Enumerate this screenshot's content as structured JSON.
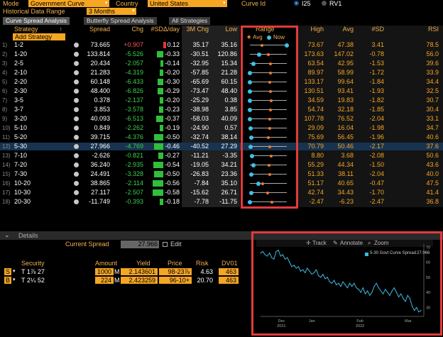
{
  "top": {
    "mode_label": "Mode",
    "mode_value": "Government Curve",
    "country_label": "Country",
    "country_value": "United States",
    "curve_id_label": "Curve Id",
    "radio1": "I25",
    "radio2": "RV1",
    "hist_label": "Historical Data Range",
    "hist_value": "3 Months"
  },
  "tabs": [
    "Curve Spread Analysis",
    "Butterfly Spread Analysis",
    "All Strategies"
  ],
  "columns": {
    "strategy": "Strategy",
    "spread": "Spread",
    "chg": "Chg",
    "sd_day": "#SDΔ/day",
    "chg3m": "3M Chg",
    "low": "Low",
    "range": "Range",
    "high": "High",
    "avg": "Avg",
    "sd": "#SD",
    "rsi": "RSI"
  },
  "legend": {
    "avg": "Avg",
    "now": "Now"
  },
  "add_strategy": "Add Strategy",
  "rows": [
    {
      "n": "1)",
      "name": "1-2",
      "spread": "73.665",
      "chg": "+0.907",
      "sd_day": "0.12",
      "chg3m": "35.17",
      "low": "35.16",
      "high": "73.67",
      "avg": "47.38",
      "sd": "3.41",
      "rsi": "78.5",
      "pos_now": 1.0,
      "pos_avg": 0.32,
      "bar": 0.2
    },
    {
      "n": "2)",
      "name": "1-20",
      "spread": "133.814",
      "chg": "-5.526",
      "sd_day": "-0.33",
      "chg3m": "-30.51",
      "low": "120.86",
      "high": "173.63",
      "avg": "147.02",
      "sd": "-0.78",
      "rsi": "56.0",
      "pos_now": 0.25,
      "pos_avg": 0.5,
      "bar": -0.5
    },
    {
      "n": "3)",
      "name": "2-5",
      "spread": "20.434",
      "chg": "-2.057",
      "sd_day": "-0.14",
      "chg3m": "-32.95",
      "low": "15.34",
      "high": "63.54",
      "avg": "42.95",
      "sd": "-1.53",
      "rsi": "39.6",
      "pos_now": 0.1,
      "pos_avg": 0.55,
      "bar": -0.2
    },
    {
      "n": "4)",
      "name": "2-10",
      "spread": "21.283",
      "chg": "-4.319",
      "sd_day": "-0.20",
      "chg3m": "-57.85",
      "low": "21.28",
      "high": "89.97",
      "avg": "58.99",
      "sd": "-1.72",
      "rsi": "33.9",
      "pos_now": 0.0,
      "pos_avg": 0.55,
      "bar": -0.3
    },
    {
      "n": "5)",
      "name": "2-20",
      "spread": "60.148",
      "chg": "-6.433",
      "sd_day": "-0.30",
      "chg3m": "-65.69",
      "low": "60.15",
      "high": "133.17",
      "avg": "99.64",
      "sd": "-1.84",
      "rsi": "34.4",
      "pos_now": 0.0,
      "pos_avg": 0.54,
      "bar": -0.45
    },
    {
      "n": "6)",
      "name": "2-30",
      "spread": "48.400",
      "chg": "-6.826",
      "sd_day": "-0.29",
      "chg3m": "-73.47",
      "low": "48.40",
      "high": "130.51",
      "avg": "93.41",
      "sd": "-1.93",
      "rsi": "32.5",
      "pos_now": 0.0,
      "pos_avg": 0.55,
      "bar": -0.43
    },
    {
      "n": "7)",
      "name": "3-5",
      "spread": "0.378",
      "chg": "-2.137",
      "sd_day": "-0.20",
      "chg3m": "-25.29",
      "low": "0.38",
      "high": "34.59",
      "avg": "19.83",
      "sd": "-1.82",
      "rsi": "30.7",
      "pos_now": 0.0,
      "pos_avg": 0.57,
      "bar": -0.3
    },
    {
      "n": "8)",
      "name": "3-7",
      "spread": "3.853",
      "chg": "-3.578",
      "sd_day": "-0.23",
      "chg3m": "-38.98",
      "low": "3.85",
      "high": "54.74",
      "avg": "32.18",
      "sd": "-1.85",
      "rsi": "30.4",
      "pos_now": 0.0,
      "pos_avg": 0.56,
      "bar": -0.35
    },
    {
      "n": "9)",
      "name": "3-20",
      "spread": "40.093",
      "chg": "-6.513",
      "sd_day": "-0.37",
      "chg3m": "-58.03",
      "low": "40.09",
      "high": "107.78",
      "avg": "76.52",
      "sd": "-2.04",
      "rsi": "33.1",
      "pos_now": 0.0,
      "pos_avg": 0.54,
      "bar": -0.55
    },
    {
      "n": "10)",
      "name": "5-10",
      "spread": "0.849",
      "chg": "-2.262",
      "sd_day": "-0.19",
      "chg3m": "-24.90",
      "low": "0.57",
      "high": "29.09",
      "avg": "16.04",
      "sd": "-1.98",
      "rsi": "34.7",
      "pos_now": 0.01,
      "pos_avg": 0.54,
      "bar": -0.28
    },
    {
      "n": "11)",
      "name": "5-20",
      "spread": "39.715",
      "chg": "-4.376",
      "sd_day": "-0.50",
      "chg3m": "-32.74",
      "low": "38.14",
      "high": "75.69",
      "avg": "56.45",
      "sd": "-1.96",
      "rsi": "40.6",
      "pos_now": 0.04,
      "pos_avg": 0.5,
      "bar": -0.75
    },
    {
      "n": "12)",
      "name": "5-30",
      "spread": "27.966",
      "chg": "-4.769",
      "sd_day": "-0.46",
      "chg3m": "-40.52",
      "low": "27.29",
      "high": "70.79",
      "avg": "50.46",
      "sd": "-2.17",
      "rsi": "37.6",
      "pos_now": 0.02,
      "pos_avg": 0.53,
      "bar": -0.7,
      "sel": true
    },
    {
      "n": "13)",
      "name": "7-10",
      "spread": "-2.626",
      "chg": "-0.821",
      "sd_day": "-0.27",
      "chg3m": "-11.21",
      "low": "-3.35",
      "high": "8.80",
      "avg": "3.68",
      "sd": "-2.08",
      "rsi": "50.6",
      "pos_now": 0.06,
      "pos_avg": 0.58,
      "bar": -0.4
    },
    {
      "n": "14)",
      "name": "7-20",
      "spread": "36.240",
      "chg": "-2.935",
      "sd_day": "-0.54",
      "chg3m": "-19.05",
      "low": "34.21",
      "high": "55.29",
      "avg": "44.34",
      "sd": "-1.50",
      "rsi": "43.6",
      "pos_now": 0.1,
      "pos_avg": 0.52,
      "bar": -0.8
    },
    {
      "n": "15)",
      "name": "7-30",
      "spread": "24.491",
      "chg": "-3.328",
      "sd_day": "-0.50",
      "chg3m": "-26.83",
      "low": "23.36",
      "high": "51.33",
      "avg": "38.11",
      "sd": "-2.04",
      "rsi": "40.0",
      "pos_now": 0.04,
      "pos_avg": 0.53,
      "bar": -0.75
    },
    {
      "n": "16)",
      "name": "10-20",
      "spread": "38.865",
      "chg": "-2.114",
      "sd_day": "-0.56",
      "chg3m": "-7.84",
      "low": "35.10",
      "high": "51.17",
      "avg": "40.65",
      "sd": "-0.47",
      "rsi": "47.5",
      "pos_now": 0.23,
      "pos_avg": 0.35,
      "bar": -0.82
    },
    {
      "n": "17)",
      "name": "10-30",
      "spread": "27.117",
      "chg": "-2.507",
      "sd_day": "-0.58",
      "chg3m": "-15.62",
      "low": "26.71",
      "high": "42.74",
      "avg": "34.43",
      "sd": "-1.70",
      "rsi": "41.4",
      "pos_now": 0.03,
      "pos_avg": 0.48,
      "bar": -0.85
    },
    {
      "n": "18)",
      "name": "20-30",
      "spread": "-11.749",
      "chg": "-0.393",
      "sd_day": "-0.18",
      "chg3m": "-7.78",
      "low": "-11.75",
      "high": "-2.47",
      "avg": "-6.23",
      "sd": "-2.47",
      "rsi": "36.8",
      "pos_now": 0.0,
      "pos_avg": 0.6,
      "bar": -0.27
    }
  ],
  "details": {
    "header": "Details",
    "current_spread_label": "Current Spread",
    "current_spread_value": "27.966",
    "edit_label": "Edit",
    "cols": {
      "security": "Security",
      "amount": "Amount",
      "yield": "Yield",
      "price": "Price",
      "risk": "Risk",
      "dv01": "DV01"
    },
    "legs": [
      {
        "side": "S",
        "security": "T 1⅞ 27",
        "amount": "1000",
        "unit": "M",
        "yield": "2.143601",
        "price": "98-23⅞",
        "risk": "4.63",
        "dv01": "463"
      },
      {
        "side": "B",
        "security": "T 2¼ 52",
        "amount": "224",
        "unit": "M",
        "yield": "2.423259",
        "price": "96-10+",
        "risk": "20.70",
        "dv01": "463"
      }
    ]
  },
  "mini_chart": {
    "toolbar": {
      "track": "Track",
      "annotate": "Annotate",
      "zoom": "Zoom"
    },
    "legend_label": "5-30 Govt Curve Spread",
    "legend_value": "27.966",
    "color": "#3fb6e0",
    "chart_data": {
      "type": "line",
      "series": [
        {
          "name": "5-30 Govt Curve Spread",
          "values": [
            66,
            67,
            65,
            64,
            66,
            63,
            62,
            67,
            68,
            64,
            65,
            62,
            63,
            60,
            57,
            58,
            56,
            57,
            54,
            55,
            53,
            56,
            54,
            52,
            53,
            55,
            51,
            50,
            52,
            49,
            50,
            47,
            46,
            48,
            45,
            46,
            44,
            47,
            45,
            43,
            46,
            44,
            46,
            43,
            42,
            40,
            43,
            39,
            41,
            38,
            40,
            44,
            46,
            43,
            41,
            39,
            42,
            40,
            38,
            41,
            43,
            40,
            37,
            39,
            36,
            34,
            38,
            36,
            31,
            28,
            30,
            27,
            28
          ]
        }
      ],
      "ylim": [
        25,
        72
      ],
      "yticks": [
        30,
        40,
        50,
        60,
        70
      ],
      "xticks": [
        "Dec",
        "Jan",
        "Feb",
        "Mar"
      ],
      "xyears": [
        "2021",
        "2022"
      ],
      "grid": false
    }
  }
}
